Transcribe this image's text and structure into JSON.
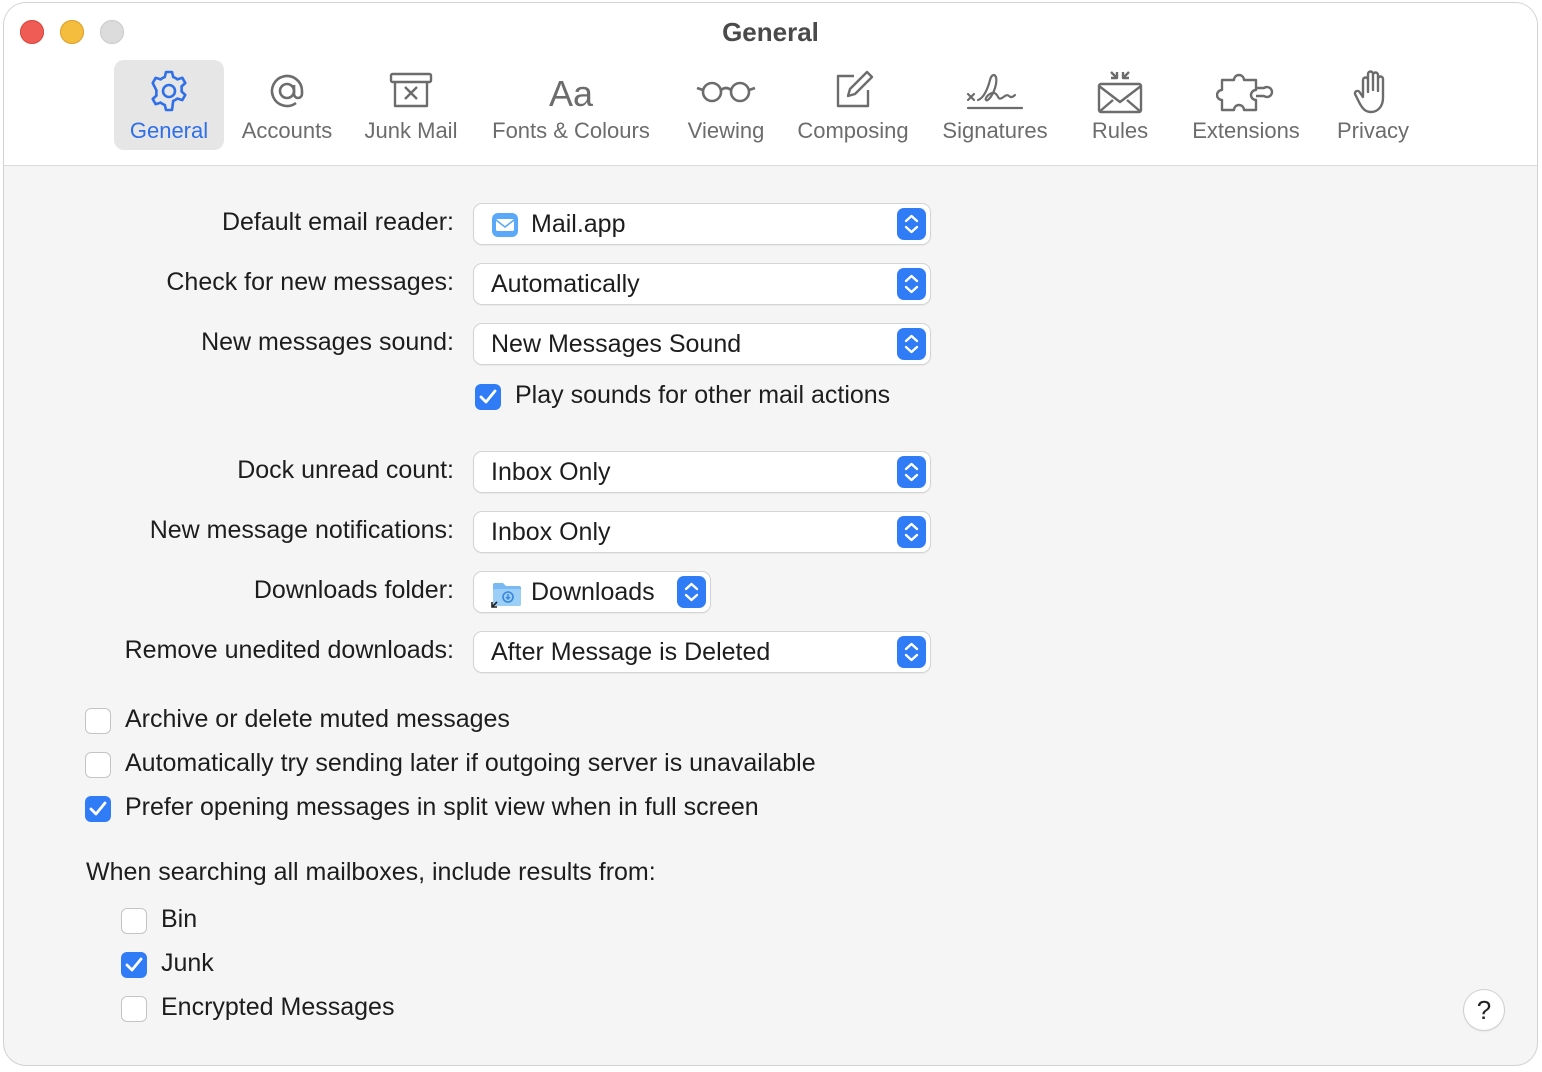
{
  "window": {
    "title": "General"
  },
  "toolbar": {
    "tabs": [
      {
        "label": "General",
        "icon": "gear-icon",
        "active": true
      },
      {
        "label": "Accounts",
        "icon": "at-icon"
      },
      {
        "label": "Junk Mail",
        "icon": "junk-tray-icon"
      },
      {
        "label": "Fonts & Colours",
        "icon": "text-aa-icon"
      },
      {
        "label": "Viewing",
        "icon": "glasses-icon"
      },
      {
        "label": "Composing",
        "icon": "compose-icon"
      },
      {
        "label": "Signatures",
        "icon": "signature-icon"
      },
      {
        "label": "Rules",
        "icon": "envelope-rules-icon"
      },
      {
        "label": "Extensions",
        "icon": "puzzle-icon"
      },
      {
        "label": "Privacy",
        "icon": "hand-icon"
      }
    ]
  },
  "settings": {
    "default_reader": {
      "label": "Default email reader:",
      "value": "Mail.app",
      "icon": "mail-app-icon"
    },
    "check_messages": {
      "label": "Check for new messages:",
      "value": "Automatically"
    },
    "sound": {
      "label": "New messages sound:",
      "value": "New Messages Sound"
    },
    "play_sounds": {
      "label": "Play sounds for other mail actions",
      "checked": true
    },
    "dock_count": {
      "label": "Dock unread count:",
      "value": "Inbox Only"
    },
    "notifications": {
      "label": "New message notifications:",
      "value": "Inbox Only"
    },
    "downloads_folder": {
      "label": "Downloads folder:",
      "value": "Downloads",
      "icon": "folder-icon"
    },
    "remove_downloads": {
      "label": "Remove unedited downloads:",
      "value": "After Message is Deleted"
    }
  },
  "options": [
    {
      "label": "Archive or delete muted messages",
      "checked": false
    },
    {
      "label": "Automatically try sending later if outgoing server is unavailable",
      "checked": false
    },
    {
      "label": "Prefer opening messages in split view when in full screen",
      "checked": true
    }
  ],
  "search": {
    "label": "When searching all mailboxes, include results from:",
    "items": [
      {
        "label": "Bin",
        "checked": false
      },
      {
        "label": "Junk",
        "checked": true
      },
      {
        "label": "Encrypted Messages",
        "checked": false
      }
    ]
  },
  "help": {
    "label": "?"
  },
  "colors": {
    "accent": "#2f7cf6",
    "active_tab": "#2f6fe8",
    "close": "#ee5c55",
    "minimize": "#f4bd3d"
  }
}
